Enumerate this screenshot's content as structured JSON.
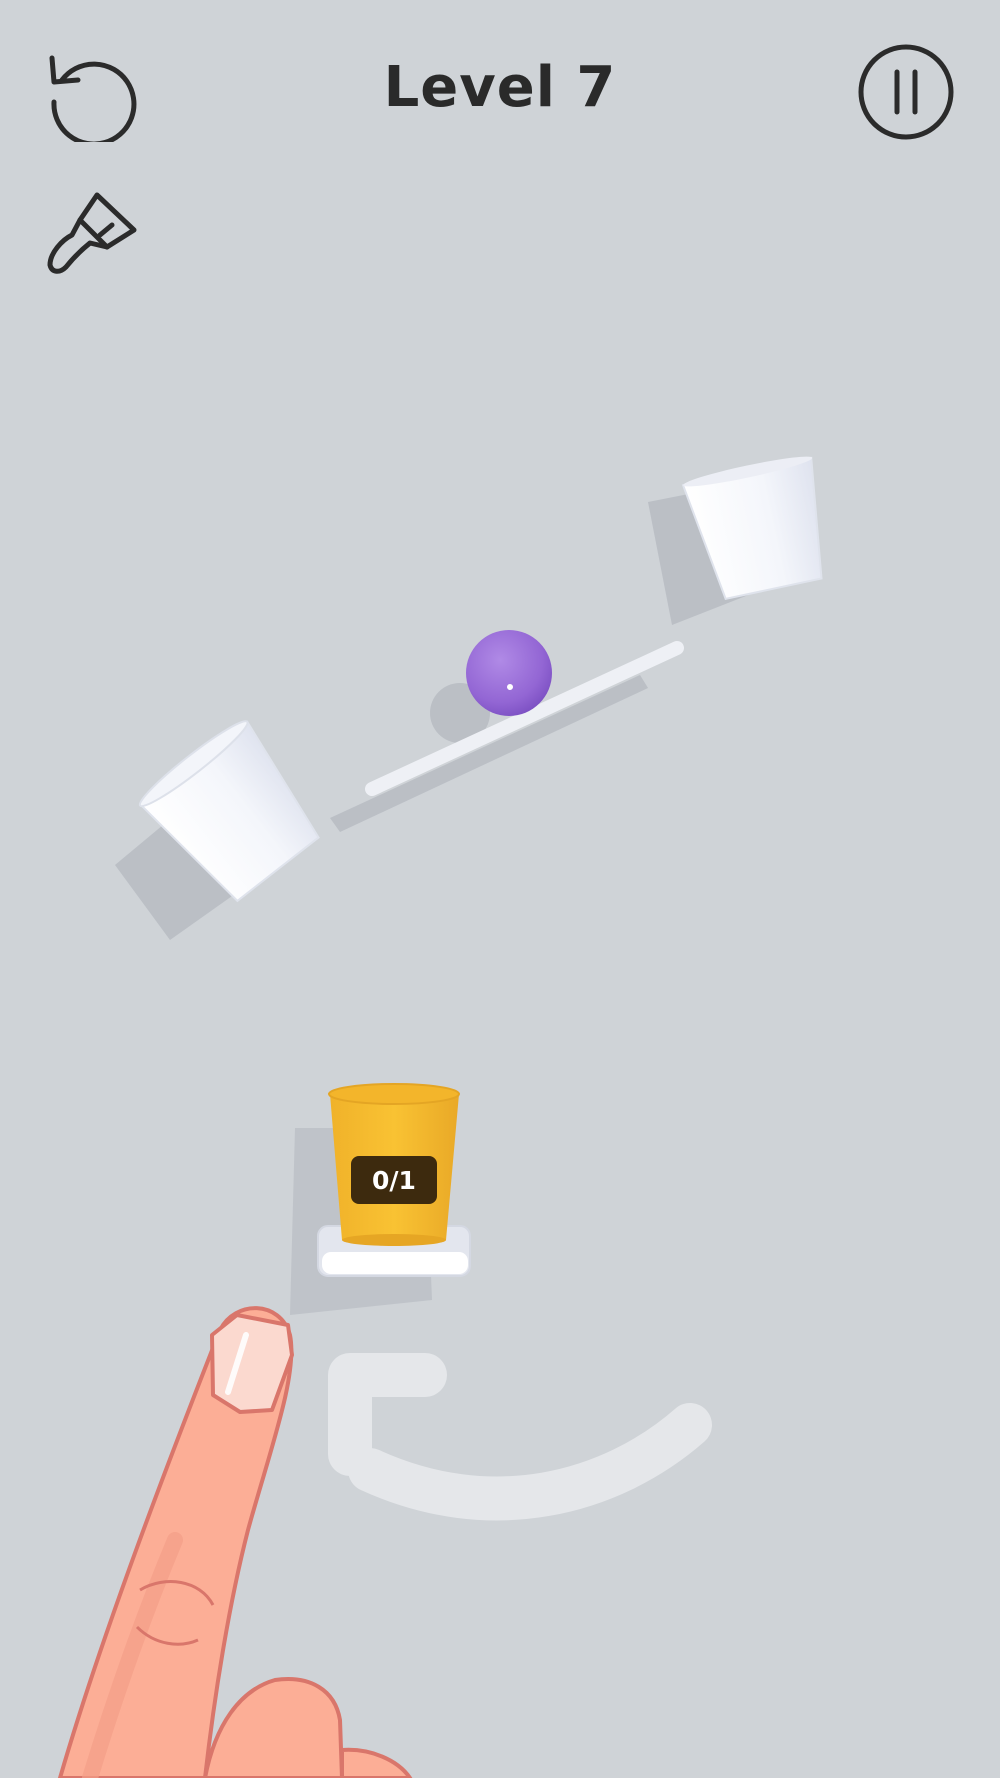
{
  "header": {
    "level_title": "Level 7"
  },
  "toolbar": {
    "restart_icon": "restart-icon",
    "pause_icon": "pause-icon",
    "skin_icon": "paint-brush-icon"
  },
  "target_cup": {
    "counter": "0/1",
    "color": "#f6b82a"
  },
  "ball": {
    "color": "#9a6fd6"
  },
  "tutorial": {
    "hand_icon": "tap-finger-icon",
    "arrow_icon": "curved-arrow-icon"
  }
}
